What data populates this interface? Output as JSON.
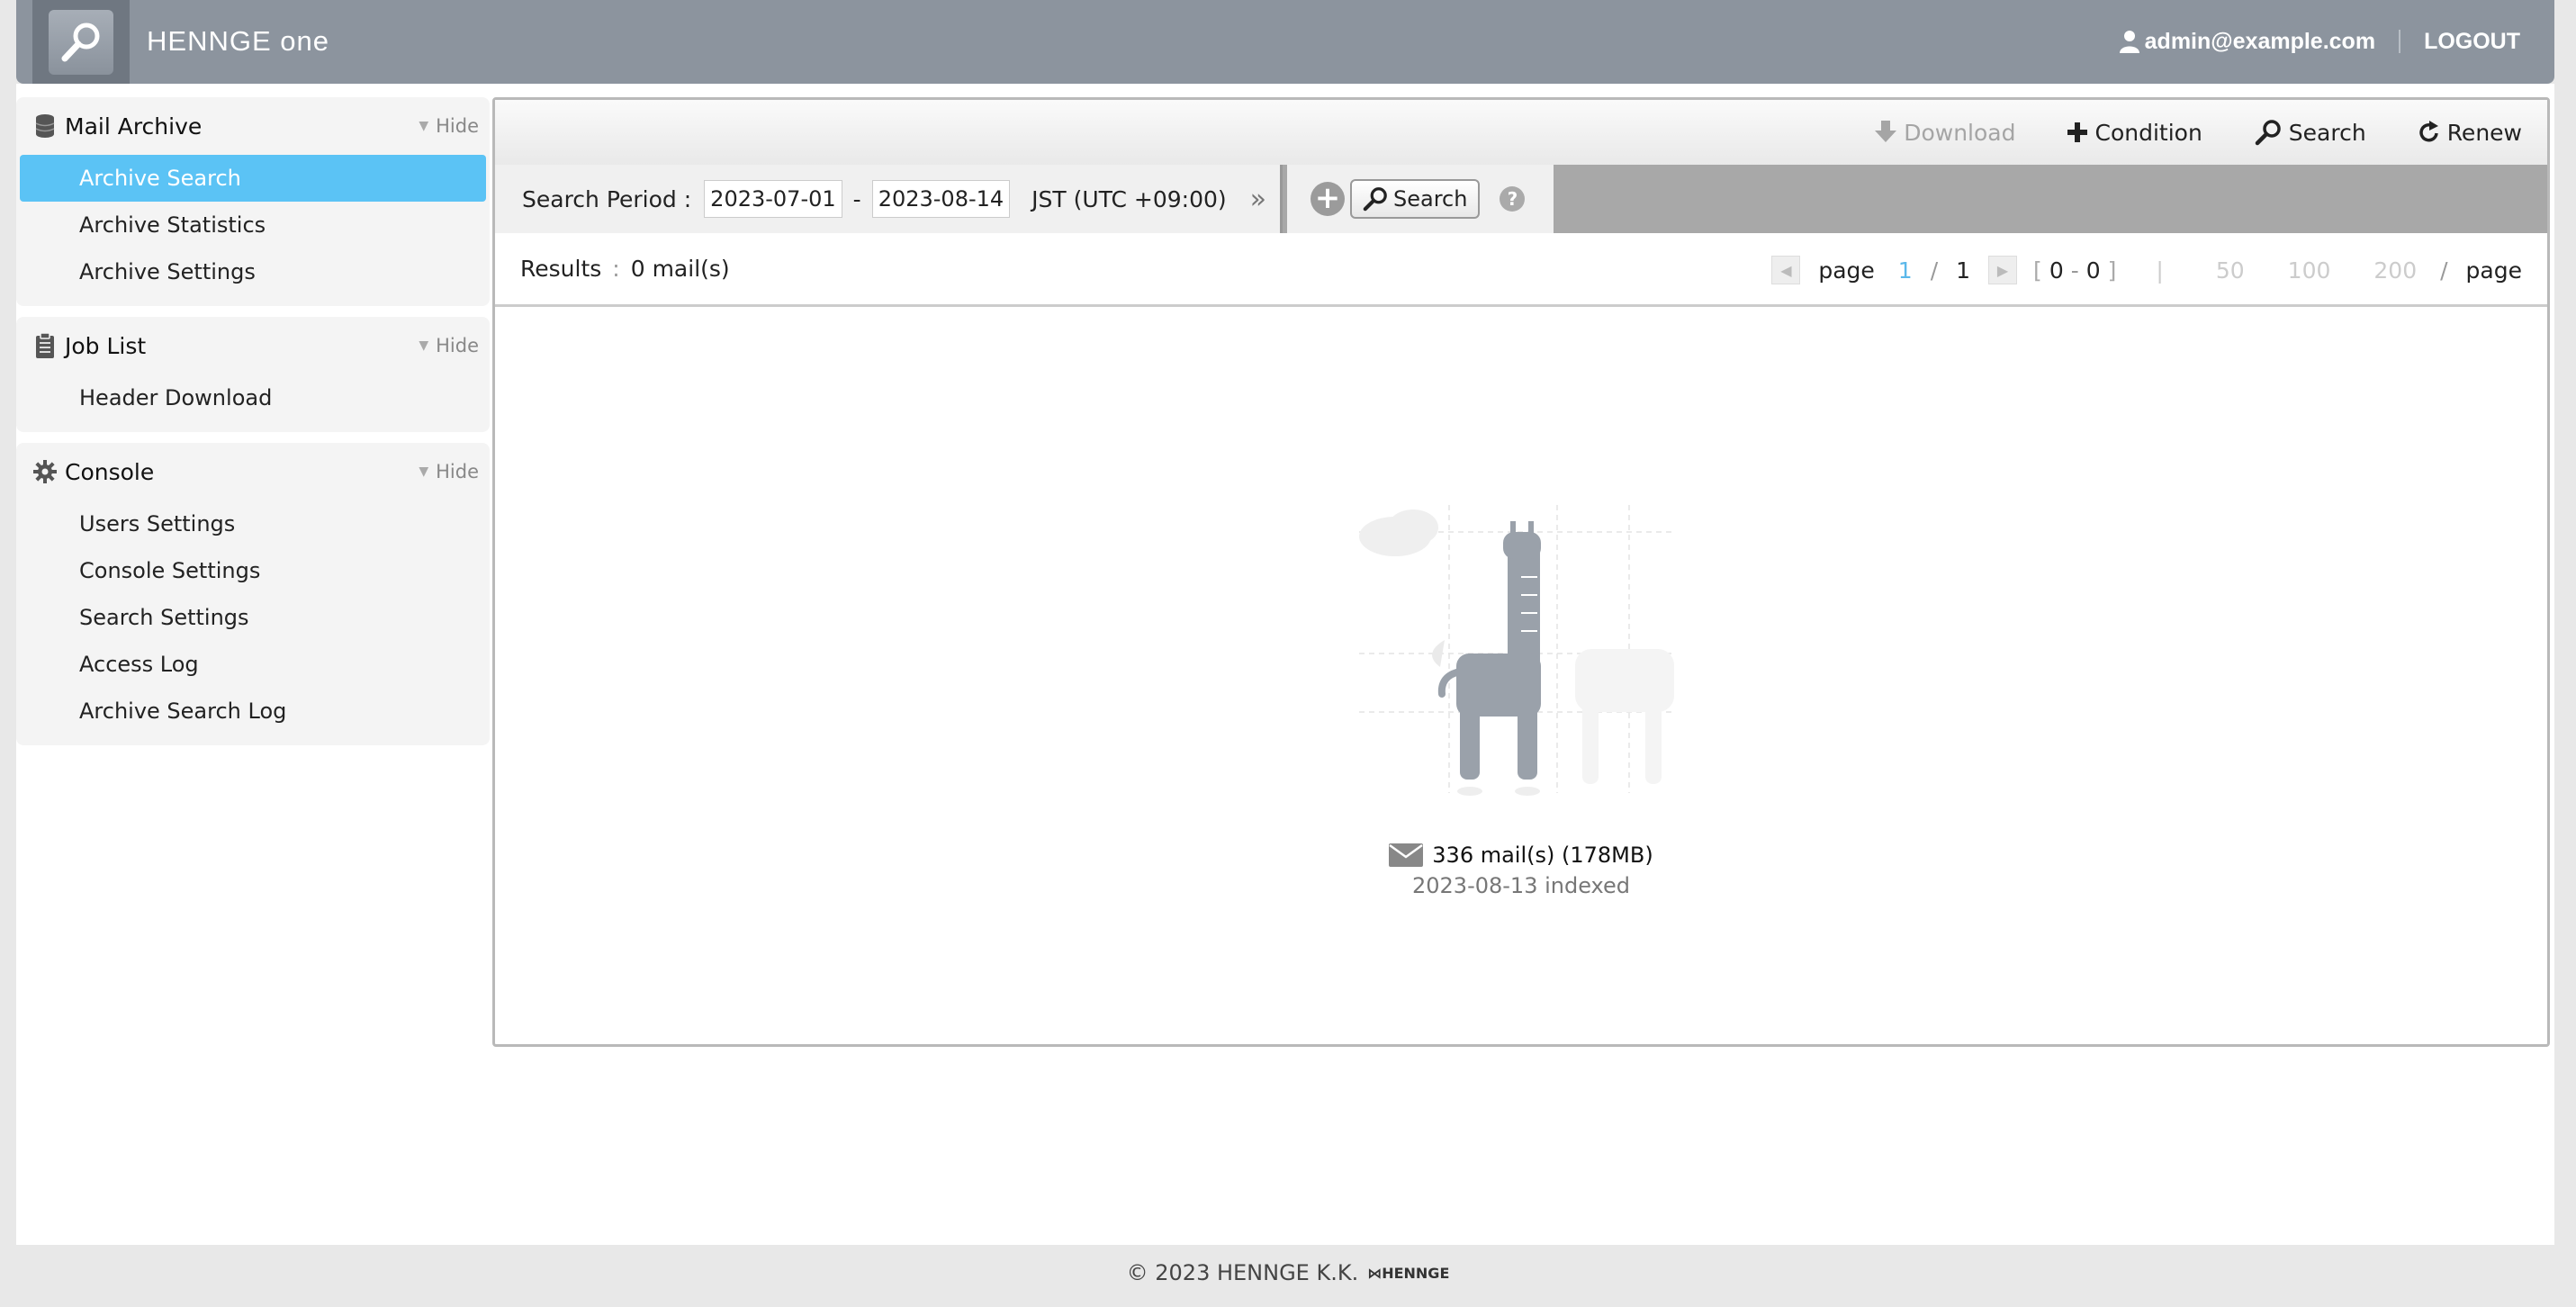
{
  "header": {
    "brand": "HENNGE one",
    "user_email": "admin@example.com",
    "logout_label": "LOGOUT"
  },
  "sidebar": {
    "sections": [
      {
        "title": "Mail Archive",
        "hide_label": "Hide",
        "icon": "database-icon",
        "items": [
          "Archive Search",
          "Archive Statistics",
          "Archive Settings"
        ],
        "active_index": 0
      },
      {
        "title": "Job List",
        "hide_label": "Hide",
        "icon": "clipboard-icon",
        "items": [
          "Header Download"
        ]
      },
      {
        "title": "Console",
        "hide_label": "Hide",
        "icon": "gear-icon",
        "items": [
          "Users Settings",
          "Console Settings",
          "Search Settings",
          "Access Log",
          "Archive Search Log"
        ]
      }
    ]
  },
  "toolbar": {
    "download_label": "Download",
    "condition_label": "Condition",
    "search_label": "Search",
    "renew_label": "Renew"
  },
  "period": {
    "label": "Search Period :",
    "from": "2023-07-01",
    "dash": "-",
    "to": "2023-08-14",
    "timezone": "JST (UTC +09:00)",
    "search_button": "Search"
  },
  "results": {
    "label": "Results",
    "count": "0 mail(s)",
    "page_word": "page",
    "current_page": "1",
    "total_pages": "1",
    "range_from": "0",
    "range_to": "0",
    "per_page_options": [
      "50",
      "100",
      "200"
    ],
    "per_page_suffix": "page"
  },
  "stats": {
    "total": "336 mail(s) (178MB)",
    "indexed": "2023-08-13 indexed"
  },
  "footer": {
    "copyright": "© 2023 HENNGE K.K.",
    "logo_text": "HENNGE"
  },
  "colors": {
    "header_bg": "#8c949e",
    "active_item": "#5bc3f5",
    "page_current": "#5bb8ea"
  }
}
